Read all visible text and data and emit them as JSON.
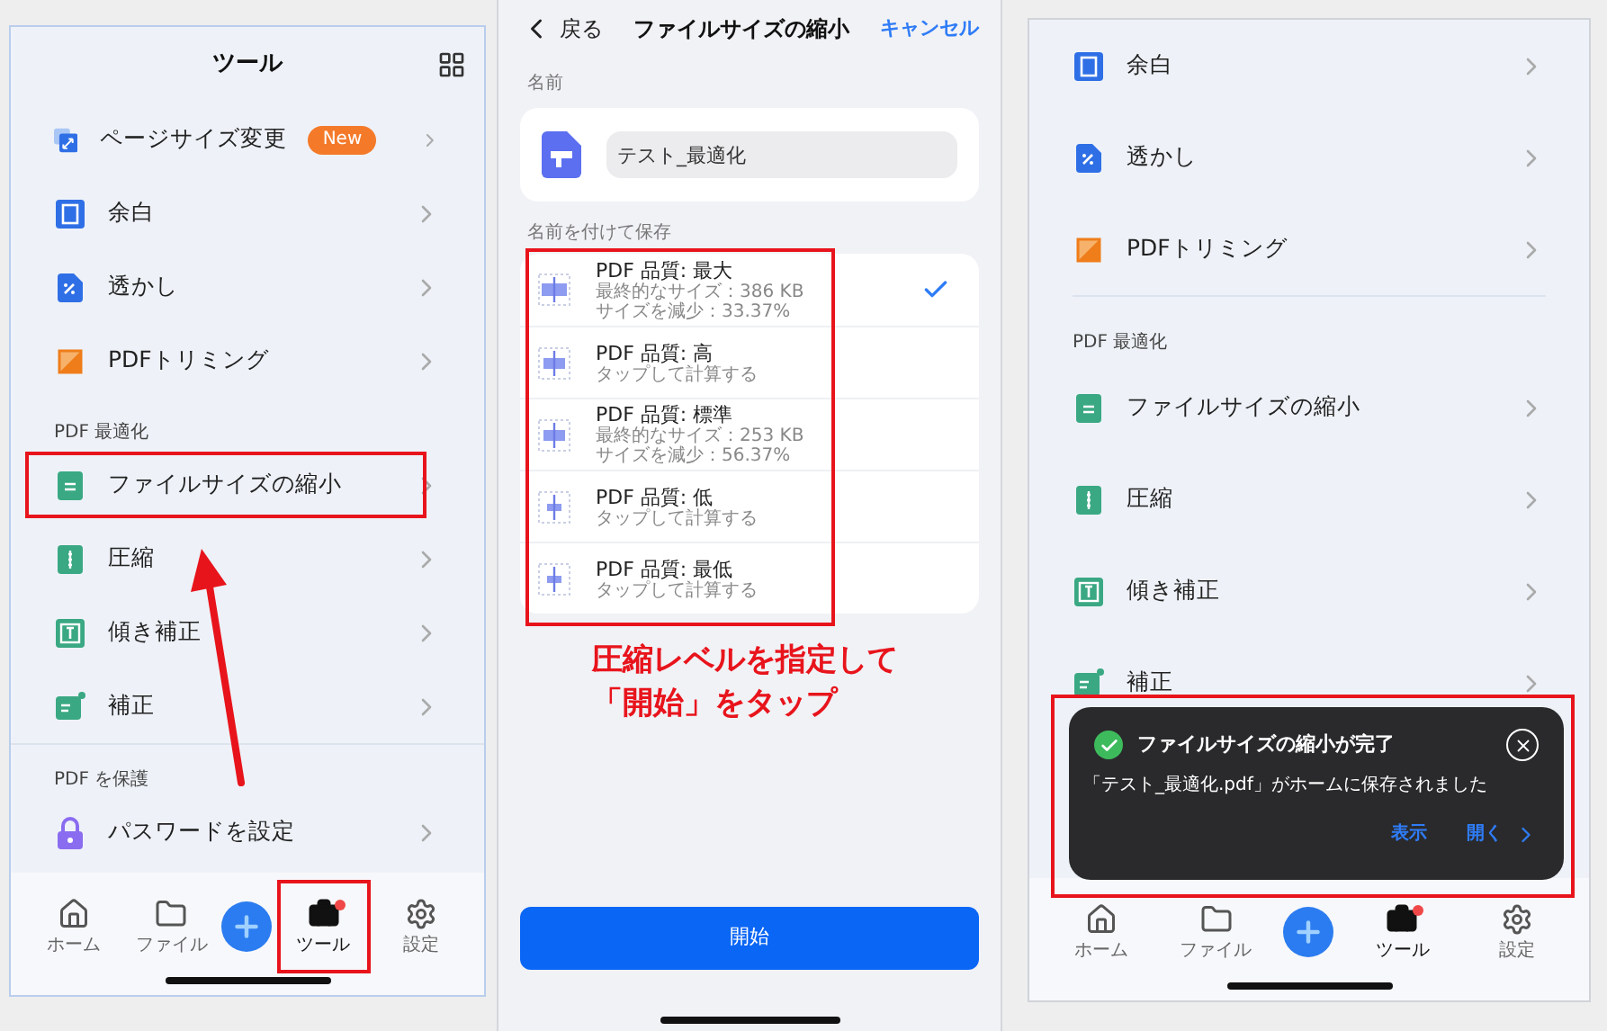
{
  "tools_screen": {
    "title": "ツール",
    "sections": [
      {
        "items": [
          {
            "kind": "resize",
            "label": "ページサイズ変更",
            "badge": "New",
            "highlighted": false
          },
          {
            "kind": "margin",
            "label": "余白",
            "highlighted": false
          },
          {
            "kind": "watermark",
            "label": "透かし",
            "highlighted": false
          },
          {
            "kind": "crop",
            "label": "PDFトリミング",
            "highlighted": false
          }
        ]
      },
      {
        "heading": "PDF 最適化",
        "items": [
          {
            "kind": "reduce",
            "label": "ファイルサイズの縮小",
            "highlighted": true
          },
          {
            "kind": "compress",
            "label": "圧縮",
            "highlighted": false
          },
          {
            "kind": "deskew",
            "label": "傾き補正",
            "highlighted": false
          },
          {
            "kind": "correct",
            "label": "補正",
            "highlighted": false
          }
        ]
      },
      {
        "heading": "PDF を保護",
        "items": [
          {
            "kind": "lock",
            "label": "パスワードを設定",
            "highlighted": false
          }
        ]
      }
    ],
    "tabs": [
      {
        "kind": "home",
        "label": "ホーム",
        "selected": false,
        "dot": false,
        "highlighted": false
      },
      {
        "kind": "file",
        "label": "ファイル",
        "selected": false,
        "dot": false,
        "highlighted": false
      },
      {
        "kind": "tools",
        "label": "ツール",
        "selected": true,
        "dot": true,
        "highlighted": true
      },
      {
        "kind": "settings",
        "label": "設定",
        "selected": false,
        "dot": false,
        "highlighted": false
      }
    ]
  },
  "compress_screen": {
    "back": "戻る",
    "title": "ファイルサイズの縮小",
    "cancel": "キャンセル",
    "name_label": "名前",
    "filename": "テスト_最適化",
    "save_label": "名前を付けて保存",
    "options_highlighted": true,
    "options": [
      {
        "title": "PDF 品質: 最大",
        "lines": [
          "最終的なサイズ：386 KB",
          "サイズを減少：33.37%"
        ],
        "selected": true
      },
      {
        "title": "PDF 品質: 高",
        "lines": [
          "タップして計算する"
        ],
        "selected": false
      },
      {
        "title": "PDF 品質: 標準",
        "lines": [
          "最終的なサイズ：253 KB",
          "サイズを減少：56.37%"
        ],
        "selected": false
      },
      {
        "title": "PDF 品質: 低",
        "lines": [
          "タップして計算する"
        ],
        "selected": false
      },
      {
        "title": "PDF 品質: 最低",
        "lines": [
          "タップして計算する"
        ],
        "selected": false
      }
    ],
    "annotation": [
      "圧縮レベルを指定して",
      "「開始」をタップ"
    ],
    "start": "開始"
  },
  "result_screen": {
    "sections": [
      {
        "items": [
          {
            "kind": "margin",
            "label": "余白"
          },
          {
            "kind": "watermark",
            "label": "透かし"
          },
          {
            "kind": "crop",
            "label": "PDFトリミング"
          }
        ]
      },
      {
        "heading": "PDF 最適化",
        "items": [
          {
            "kind": "reduce",
            "label": "ファイルサイズの縮小"
          },
          {
            "kind": "compress",
            "label": "圧縮"
          },
          {
            "kind": "deskew",
            "label": "傾き補正"
          },
          {
            "kind": "correct",
            "label": "補正"
          }
        ]
      }
    ],
    "toast": {
      "title": "ファイルサイズの縮小が完了",
      "message": "「テスト_最適化.pdf」がホームに保存されました",
      "actions": [
        "表示",
        "開く"
      ],
      "highlighted": true
    },
    "tabs": [
      {
        "kind": "home",
        "label": "ホーム",
        "selected": false,
        "dot": false
      },
      {
        "kind": "file",
        "label": "ファイル",
        "selected": false,
        "dot": false
      },
      {
        "kind": "tools",
        "label": "ツール",
        "selected": true,
        "dot": true
      },
      {
        "kind": "settings",
        "label": "設定",
        "selected": false,
        "dot": false
      }
    ]
  }
}
